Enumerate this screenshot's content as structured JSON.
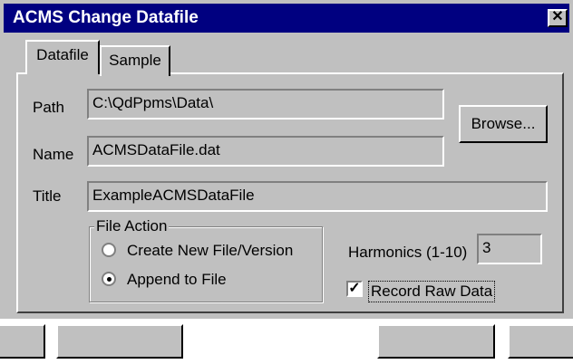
{
  "window": {
    "title": "ACMS Change Datafile",
    "close_glyph": "✕"
  },
  "tabs": [
    {
      "label": "Datafile",
      "active": true
    },
    {
      "label": "Sample",
      "active": false
    }
  ],
  "fields": {
    "path_label": "Path",
    "path_value": "C:\\QdPpms\\Data\\",
    "name_label": "Name",
    "name_value": "ACMSDataFile.dat",
    "title_label": "Title",
    "title_value": "ExampleACMSDataFile"
  },
  "browse_button": "Browse...",
  "file_action": {
    "title": "File Action",
    "options": [
      {
        "label": "Create New File/Version",
        "selected": false
      },
      {
        "label": "Append to File",
        "selected": true
      }
    ]
  },
  "harmonics": {
    "label": "Harmonics (1-10)",
    "value": "3"
  },
  "record_raw": {
    "label": "Record Raw Data",
    "checked": true,
    "check_glyph": "✓"
  },
  "colors": {
    "title_bar": "#000080",
    "face": "#c0c0c0"
  }
}
